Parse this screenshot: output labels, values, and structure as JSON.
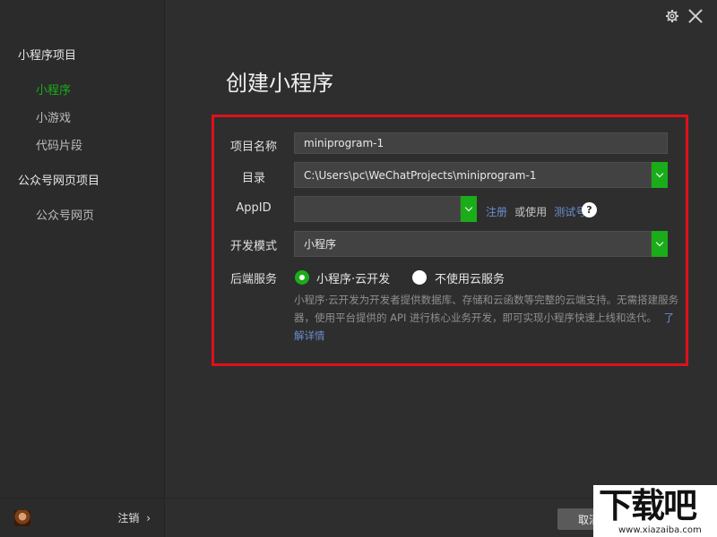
{
  "sidebar": {
    "groups": [
      {
        "label": "小程序项目",
        "items": [
          "小程序",
          "小游戏",
          "代码片段"
        ]
      },
      {
        "label": "公众号网页项目",
        "items": [
          "公众号网页"
        ]
      }
    ],
    "logout_label": "注销"
  },
  "main": {
    "title": "创建小程序",
    "form": {
      "project_name_label": "项目名称",
      "project_name_value": "miniprogram-1",
      "directory_label": "目录",
      "directory_value": "C:\\Users\\pc\\WeChatProjects\\miniprogram-1",
      "appid_label": "AppID",
      "appid_value": "",
      "register_link": "注册",
      "or_use_text": "或使用",
      "test_account_link": "测试号",
      "help_glyph": "?",
      "dev_mode_label": "开发模式",
      "dev_mode_value": "小程序",
      "backend_label": "后端服务",
      "backend_options": [
        "小程序·云开发",
        "不使用云服务"
      ],
      "backend_selected": 0,
      "description": "小程序·云开发为开发者提供数据库、存储和云函数等完整的云端支持。无需搭建服务器，使用平台提供的 API 进行核心业务开发，即可实现小程序快速上线和迭代。",
      "learn_more_link": "了解详情"
    },
    "cancel_button": "取消"
  },
  "watermark": {
    "mark": "下载吧",
    "url": "www.xiazaiba.com"
  },
  "colors": {
    "accent": "#1aad19",
    "highlight_border": "#e0101a",
    "link": "#6a8fcf"
  },
  "icons": [
    "gear-icon",
    "close-icon",
    "chevron-down-icon",
    "help-icon",
    "chevron-right-icon"
  ]
}
